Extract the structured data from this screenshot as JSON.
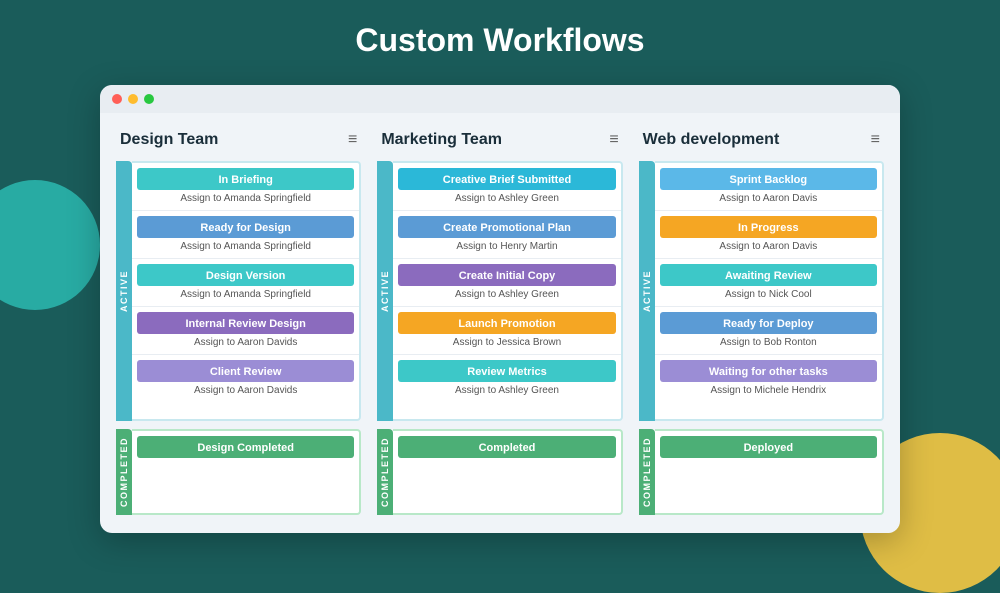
{
  "page": {
    "title": "Custom Workflows"
  },
  "columns": [
    {
      "id": "design-team",
      "title": "Design Team",
      "active_label": "ACTIVE",
      "completed_label": "COMPLETED",
      "cards": [
        {
          "label": "In Briefing",
          "assignee": "Assign to Amanda Springfield",
          "color": "color-teal"
        },
        {
          "label": "Ready for Design",
          "assignee": "Assign to Amanda Springfield",
          "color": "color-blue"
        },
        {
          "label": "Design Version",
          "assignee": "Assign to Amanda Springfield",
          "color": "color-teal"
        },
        {
          "label": "Internal Review Design",
          "assignee": "Assign to Aaron Davids",
          "color": "color-purple"
        },
        {
          "label": "Client Review",
          "assignee": "Assign to Aaron Davids",
          "color": "color-lavender"
        }
      ],
      "completed": [
        {
          "label": "Design Completed",
          "assignee": "",
          "color": "color-green"
        }
      ]
    },
    {
      "id": "marketing-team",
      "title": "Marketing Team",
      "active_label": "ACTIVE",
      "completed_label": "COMPLETED",
      "cards": [
        {
          "label": "Creative Brief Submitted",
          "assignee": "Assign to Ashley Green",
          "color": "color-cyan"
        },
        {
          "label": "Create Promotional Plan",
          "assignee": "Assign to Henry Martin",
          "color": "color-blue"
        },
        {
          "label": "Create Initial Copy",
          "assignee": "Assign to Ashley Green",
          "color": "color-purple"
        },
        {
          "label": "Launch Promotion",
          "assignee": "Assign to Jessica Brown",
          "color": "color-orange"
        },
        {
          "label": "Review Metrics",
          "assignee": "Assign to Ashley Green",
          "color": "color-teal"
        }
      ],
      "completed": [
        {
          "label": "Completed",
          "assignee": "",
          "color": "color-green"
        }
      ]
    },
    {
      "id": "web-development",
      "title": "Web development",
      "active_label": "ACTIVE",
      "completed_label": "COMPLETED",
      "cards": [
        {
          "label": "Sprint Backlog",
          "assignee": "Assign to Aaron Davis",
          "color": "color-sky"
        },
        {
          "label": "In Progress",
          "assignee": "Assign to Aaron Davis",
          "color": "color-orange"
        },
        {
          "label": "Awaiting Review",
          "assignee": "Assign to Nick Cool",
          "color": "color-teal"
        },
        {
          "label": "Ready for Deploy",
          "assignee": "Assign to Bob Ronton",
          "color": "color-blue"
        },
        {
          "label": "Waiting for other tasks",
          "assignee": "Assign to Michele Hendrix",
          "color": "color-lavender"
        }
      ],
      "completed": [
        {
          "label": "Deployed",
          "assignee": "",
          "color": "color-green"
        }
      ]
    }
  ],
  "icons": {
    "menu": "≡",
    "dots": "●●●"
  }
}
